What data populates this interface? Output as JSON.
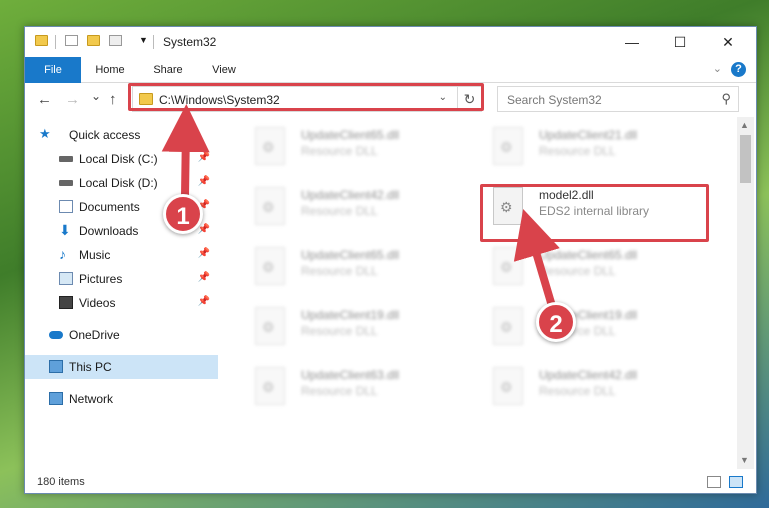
{
  "window": {
    "title": "System32",
    "minimize_glyph": "—",
    "maximize_glyph": "☐",
    "close_glyph": "✕"
  },
  "ribbon": {
    "tabs": [
      "File",
      "Home",
      "Share",
      "View"
    ],
    "help_glyph": "?"
  },
  "nav": {
    "back_glyph": "←",
    "forward_glyph": "→",
    "recent_glyph": "⌄",
    "up_glyph": "↑",
    "address": "C:\\Windows\\System32",
    "search_placeholder": "Search System32"
  },
  "sidebar": {
    "items": [
      {
        "label": "Quick access",
        "icon": "star-icon"
      },
      {
        "label": "Local Disk (C:)",
        "icon": "drive-icon"
      },
      {
        "label": "Local Disk (D:)",
        "icon": "drive-icon"
      },
      {
        "label": "Documents",
        "icon": "documents-icon"
      },
      {
        "label": "Downloads",
        "icon": "downloads-icon"
      },
      {
        "label": "Music",
        "icon": "music-icon"
      },
      {
        "label": "Pictures",
        "icon": "pictures-icon"
      },
      {
        "label": "Videos",
        "icon": "videos-icon"
      },
      {
        "label": "OneDrive",
        "icon": "cloud-icon"
      },
      {
        "label": "This PC",
        "icon": "computer-icon"
      },
      {
        "label": "Network",
        "icon": "network-icon"
      }
    ]
  },
  "files": [
    {
      "name": "UpdateClient65.dll",
      "desc": "Resource DLL"
    },
    {
      "name": "UpdateClient21.dll",
      "desc": "Resource DLL"
    },
    {
      "name": "UpdateClient42.dll",
      "desc": "Resource DLL"
    },
    {
      "name": "model2.dll",
      "desc": "EDS2 internal library"
    },
    {
      "name": "UpdateClient65.dll",
      "desc": "Resource DLL"
    },
    {
      "name": "UpdateClient65.dll",
      "desc": "Resource DLL"
    },
    {
      "name": "UpdateClient19.dll",
      "desc": "Resource DLL"
    },
    {
      "name": "UpdateClient19.dll",
      "desc": "Resource DLL"
    },
    {
      "name": "UpdateClient63.dll",
      "desc": "Resource DLL"
    },
    {
      "name": "UpdateClient42.dll",
      "desc": "Resource DLL"
    }
  ],
  "status": {
    "count": "180 items"
  },
  "annotations": {
    "step1": "1",
    "step2": "2"
  },
  "colors": {
    "accent": "#1979ca",
    "highlight": "#d9434b",
    "selected": "#cce4f7"
  }
}
